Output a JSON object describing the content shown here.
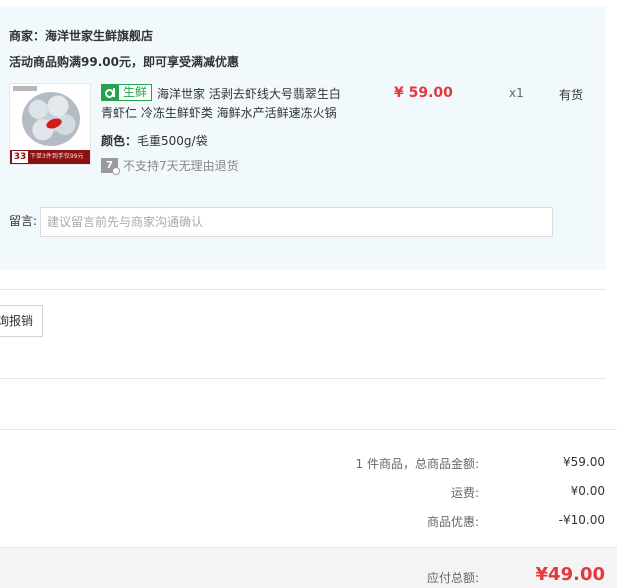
{
  "store": {
    "merchant": "商家：海洋世家生鲜旗舰店",
    "promo": "活动商品购满99.00元，即可享受满减优惠"
  },
  "product": {
    "image_caption_number": "33",
    "image_caption_text": "下单3件到手仅99元",
    "tag_icon": "fresh-logo-icon",
    "tag_label": "生鲜",
    "title_line1": "海洋世家 活剥去虾线大号翡翠生白",
    "title_line2": "青虾仁 冷冻生鲜虾类 海鲜水产活鲜速冻火锅",
    "attr_label": "颜色：",
    "attr_value": "毛重500g/袋",
    "no_return_icon_text": "7",
    "no_return_text": "不支持7天无理由退货",
    "price": "¥ 59.00",
    "quantity": "x1",
    "stock": "有货"
  },
  "message": {
    "label": "留言:",
    "placeholder": "建议留言前先与商家沟通确认"
  },
  "invoice": {
    "button_label": "询报销"
  },
  "summary": {
    "count": "1",
    "count_suffix": " 件商品，总商品金额:",
    "subtotal": "¥59.00",
    "shipping_label": "运费:",
    "shipping": "¥0.00",
    "discount_label": "商品优惠:",
    "discount": "-¥10.00",
    "total_label": "应付总额:",
    "total": "¥49.00"
  },
  "colors": {
    "panel_bg": "#f2f9fd",
    "price_red": "#e4393c",
    "fresh_green": "#23a34d"
  }
}
